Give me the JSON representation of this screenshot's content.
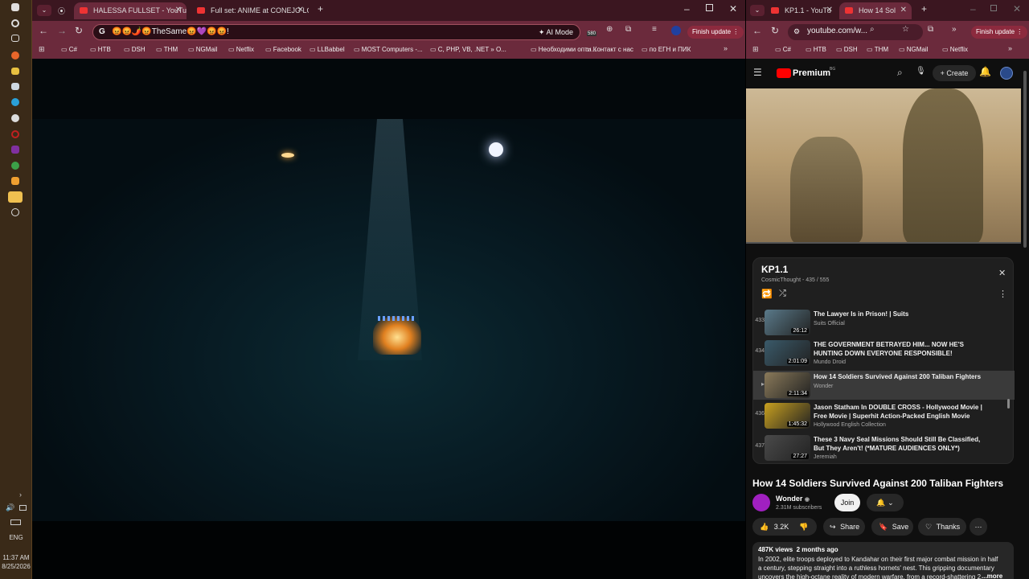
{
  "taskbar": {
    "time": "11:37 AM",
    "date": "8/25/2026",
    "lang": "ENG"
  },
  "left_window": {
    "tabs": [
      {
        "label": "HALESSA FULLSET - YouTu"
      },
      {
        "label": "Full set: ANIME at CONEJO LO"
      }
    ],
    "address": "😡😡🌶️😡TheSame😡💜😡😡!",
    "ai_mode": "AI Mode",
    "badge_count": "580",
    "finish_update": "Finish update",
    "bookmarks": [
      "C#",
      "НТВ",
      "DSH",
      "ТНМ",
      "NGMail",
      "Netflix",
      "Facebook",
      "LLBabbel",
      "MOST Computers -...",
      "C, PHP, VB, .NET » O...",
      "Необходими опти...",
      "Контакт с нас",
      "по ЕГН и ПИК"
    ]
  },
  "right_window": {
    "tabs": [
      {
        "label": "KP1.1 - YouTu"
      },
      {
        "label": "How 14 Sol"
      }
    ],
    "url": "youtube.com/w...",
    "finish_update": "Finish update",
    "bookmarks": [
      "C#",
      "НТВ",
      "DSH",
      "ТНМ",
      "NGMail",
      "Netflix"
    ],
    "yt": {
      "brand": "Premium",
      "region": "BG",
      "create": "Create"
    },
    "playlist": {
      "title": "KP1.1",
      "meta": "CosmicThought - 435 / 555",
      "items": [
        {
          "num": "433",
          "title": "The Lawyer Is in Prison! | Suits",
          "channel": "Suits Official",
          "duration": "26:12",
          "color": "#5a7a8a"
        },
        {
          "num": "434",
          "title": "THE GOVERNMENT BETRAYED HIM... NOW HE'S HUNTING DOWN EVERYONE RESPONSIBLE!",
          "channel": "Mundo Droid",
          "duration": "2:01:09",
          "color": "#3a5a6a"
        },
        {
          "num": "",
          "title": "How 14 Soldiers Survived Against 200 Taliban Fighters",
          "channel": "Wonder",
          "duration": "2:11:34",
          "color": "#8a7a5a"
        },
        {
          "num": "436",
          "title": "Jason Statham In DOUBLE CROSS - Hollywood Movie | Free Movie | Superhit Action-Packed English Movie",
          "channel": "Hollywood English Collection",
          "duration": "1:45:32",
          "color": "#c8a020"
        },
        {
          "num": "437",
          "title": "These 3 Navy Seal Missions Should Still Be Classified, But They Aren't! (*MATURE AUDIENCES ONLY*)",
          "channel": "Jeremiah",
          "duration": "27:27",
          "color": "#4a4a4a"
        }
      ]
    },
    "video": {
      "title": "How 14 Soldiers Survived Against 200 Taliban Fighters",
      "channel": "Wonder",
      "subs": "2.31M subscribers",
      "join": "Join",
      "likes": "3.2K",
      "share": "Share",
      "save": "Save",
      "thanks": "Thanks",
      "views": "487K views  2 months ago",
      "desc": "In 2002, elite troops deployed to Kandahar on their first major combat mission in half a century, stepping straight into a ruthless hornets' nest. This gripping documentary uncovers the high-octane reality of modern warfare, from a record-shattering 2.43...",
      "more": "...more"
    }
  }
}
